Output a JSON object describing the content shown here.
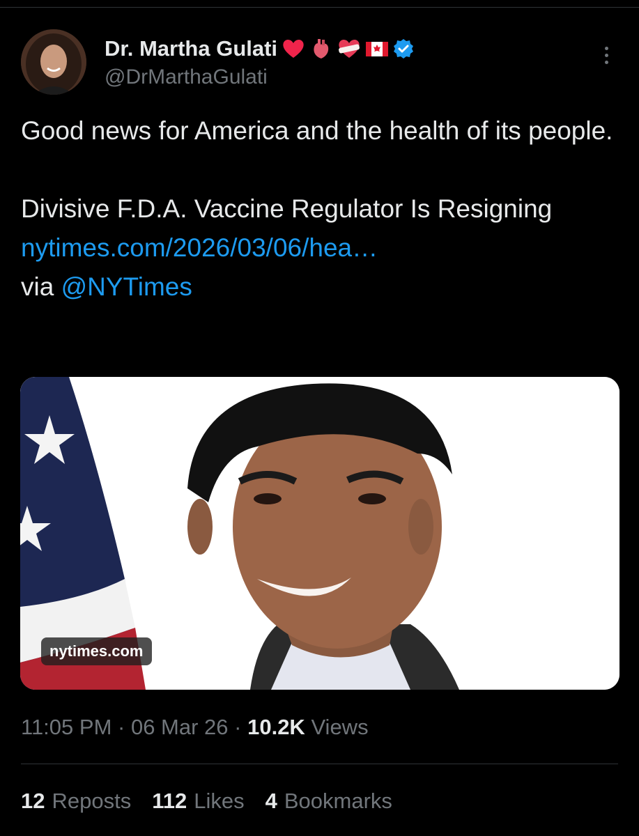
{
  "author": {
    "display_name": "Dr. Martha Gulati",
    "handle": "@DrMarthaGulati",
    "name_emojis": [
      "heart-emoji",
      "anatomical-heart-emoji",
      "heart-bandage-emoji",
      "canada-flag-emoji"
    ],
    "verified": true,
    "verified_color": "#1d9bf0"
  },
  "tweet": {
    "line1": "Good news for America and the health of its people.",
    "line2_text": "Divisive F.D.A. Vaccine Regulator Is Resigning ",
    "line2_link": "nytimes.com/2026/03/06/hea…",
    "via_text": "via ",
    "via_mention": "@NYTimes",
    "link_color": "#1d9bf0"
  },
  "card": {
    "domain": "nytimes.com"
  },
  "meta": {
    "time": "11:05 PM",
    "sep": " · ",
    "date": "06 Mar 26",
    "views_count": "10.2K",
    "views_label": " Views"
  },
  "stats": {
    "reposts_count": "12",
    "reposts_label": "Reposts",
    "likes_count": "112",
    "likes_label": "Likes",
    "bookmarks_count": "4",
    "bookmarks_label": "Bookmarks"
  }
}
